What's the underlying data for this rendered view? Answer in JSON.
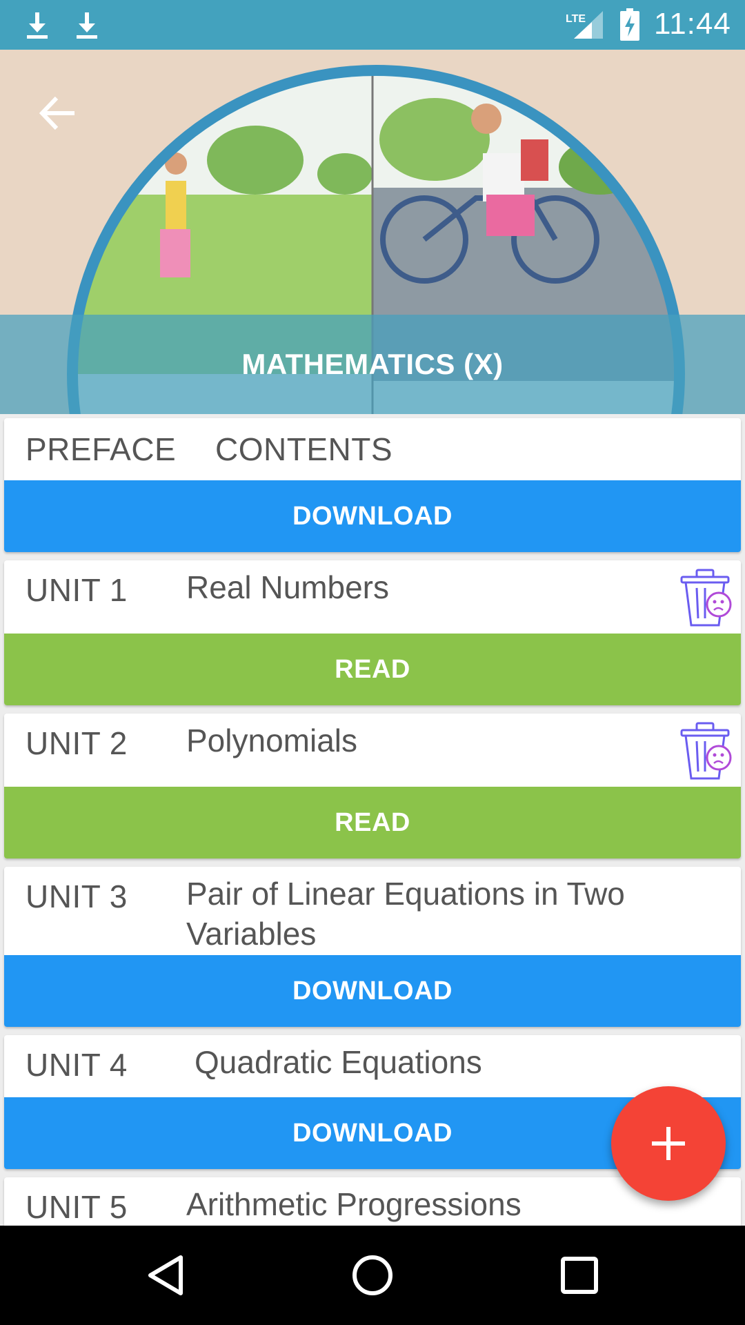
{
  "status_bar": {
    "time": "11:44",
    "network": "LTE",
    "icons": [
      "download-icon",
      "download-icon",
      "lte-signal-icon",
      "battery-charging-icon"
    ]
  },
  "header": {
    "title": "MATHEMATICS (X)",
    "back_icon": "arrow-back-icon"
  },
  "colors": {
    "status_bar": "#43a2be",
    "download_button": "#2196f3",
    "read_button": "#8bc34a",
    "fab": "#f44336",
    "trash_icon": "#7c4dff"
  },
  "intro": {
    "preface_label": "PREFACE",
    "contents_label": "CONTENTS",
    "button_label": "DOWNLOAD"
  },
  "units": [
    {
      "unit": "UNIT 1",
      "name": "Real Numbers",
      "button": "READ",
      "downloaded": true
    },
    {
      "unit": "UNIT 2",
      "name": "Polynomials",
      "button": "READ",
      "downloaded": true
    },
    {
      "unit": "UNIT 3",
      "name": "Pair of Linear Equations in Two Variables",
      "button": "DOWNLOAD",
      "downloaded": false
    },
    {
      "unit": "UNIT 4",
      "name": "Quadratic Equations",
      "button": "DOWNLOAD",
      "downloaded": false
    },
    {
      "unit": "UNIT 5",
      "name": "Arithmetic Progressions",
      "button": "",
      "downloaded": false
    }
  ],
  "fab": {
    "icon": "plus-icon"
  },
  "nav_bar": {
    "icons": [
      "back-triangle-icon",
      "home-circle-icon",
      "recents-square-icon"
    ]
  }
}
